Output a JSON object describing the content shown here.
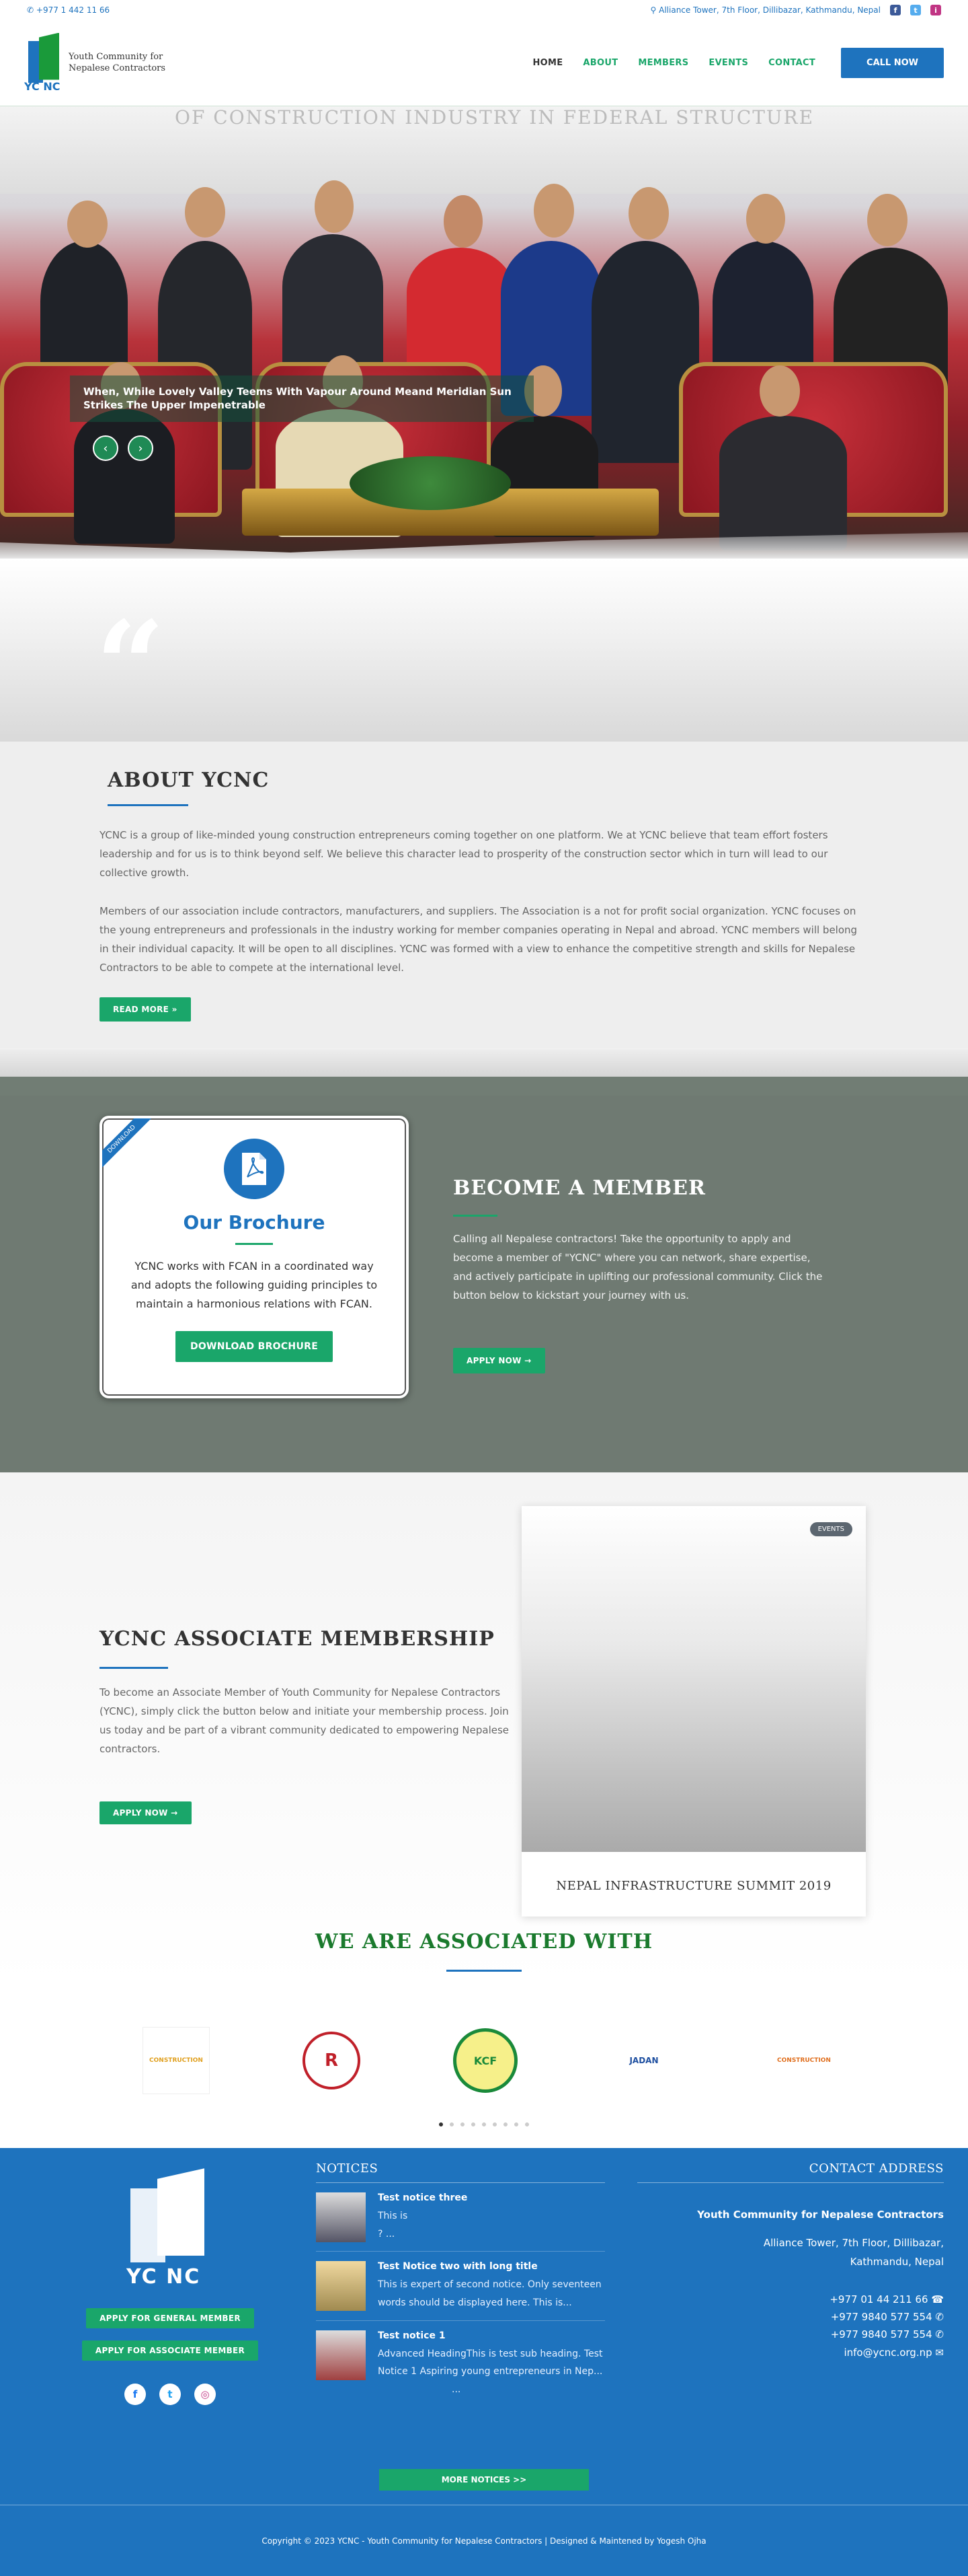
{
  "topbar": {
    "phone": "+977 1 442 11 66",
    "address": "Alliance Tower, 7th Floor, Dillibazar, Kathmandu, Nepal",
    "social": [
      {
        "name": "facebook",
        "glyph": "f",
        "color": "#3b5998"
      },
      {
        "name": "twitter",
        "glyph": "t",
        "color": "#55acee"
      },
      {
        "name": "instagram",
        "glyph": "i",
        "color": "#c13584"
      }
    ]
  },
  "brand": {
    "line1": "Youth Community for",
    "line2": "Nepalese Contractors",
    "mark": "YC NC"
  },
  "nav": {
    "items": [
      "HOME",
      "ABOUT",
      "MEMBERS",
      "EVENTS",
      "CONTACT"
    ],
    "call": "CALL NOW"
  },
  "hero": {
    "banner": "OF CONSTRUCTION INDUSTRY IN FEDERAL STRUCTURE",
    "caption": "When, While Lovely Valley Teems With Vapour Around Meand Meridian Sun Strikes The Upper Impenetrable",
    "prev": "‹",
    "next": "›"
  },
  "quote": {
    "mark": "“"
  },
  "about": {
    "title": "ABOUT YCNC",
    "p1": "YCNC is a group of like-minded young construction entrepreneurs coming together on one platform. We at YCNC believe that team effort fosters leadership and for us is to think beyond self. We believe this character lead to prosperity of the construction sector which in turn will lead to our collective growth.",
    "p2": "Members of our association include contractors, manufacturers, and suppliers. The Association is a not for profit social organization. YCNC focuses on the young entrepreneurs and professionals in the industry working for member companies operating in Nepal and abroad. YCNC members will belong in their individual capacity. It will be open to all disciplines. YCNC was formed with a view to enhance the competitive strength and skills for Nepalese Contractors to be able to compete at the international level.",
    "button": "READ MORE »"
  },
  "brochure": {
    "ribbon": "DOWNLOAD",
    "title": "Our Brochure",
    "text": "YCNC works with FCAN in a coordinated way and adopts the following guiding principles to maintain a harmonious relations with FCAN.",
    "button": "DOWNLOAD BROCHURE"
  },
  "member": {
    "title": "BECOME A MEMBER",
    "text": "Calling all Nepalese contractors! Take the opportunity to apply and become a member of \"YCNC\" where you can network, share expertise, and actively participate in uplifting our professional community. Click the button below to kickstart your journey with us.",
    "button": "APPLY NOW  →"
  },
  "associate": {
    "title": "YCNC ASSOCIATE MEMBERSHIP",
    "text": "To become an Associate Member of Youth Community for Nepalese Contractors (YCNC), simply click the button below and initiate your membership process. Join us today and be part of a vibrant community dedicated to empowering Nepalese contractors.",
    "button": "APPLY NOW  →",
    "event_badge": "EVENTS",
    "event_title": "NEPAL INFRASTRUCTURE SUMMIT 2019"
  },
  "associated": {
    "title": "WE ARE ASSOCIATED WITH",
    "partners": [
      {
        "name": "partner-1",
        "label": "CONSTRUCTION",
        "color": "#e0a020"
      },
      {
        "name": "partner-2",
        "label": "R",
        "color": "#c0202a"
      },
      {
        "name": "partner-3",
        "label": "KCF",
        "color": "#1a8a3a"
      },
      {
        "name": "partner-4",
        "label": "JADAN",
        "color": "#1e4fa0"
      },
      {
        "name": "partner-5",
        "label": "CONSTRUCTION",
        "color": "#e07020"
      }
    ]
  },
  "footer": {
    "mark": "YC NC",
    "btn_general": "APPLY FOR GENERAL MEMBER",
    "btn_associate": "APPLY FOR ASSOCIATE MEMBER",
    "social": [
      {
        "name": "facebook",
        "glyph": "f",
        "color": "#3b5998"
      },
      {
        "name": "twitter",
        "glyph": "t",
        "color": "#55acee"
      },
      {
        "name": "instagram",
        "glyph": "◎",
        "color": "#c13584"
      }
    ],
    "notices_title": "NOTICES",
    "notices": [
      {
        "title": "Test notice three",
        "excerpt": "This is",
        "more": "?                                        ..."
      },
      {
        "title": "Test Notice two with long title",
        "excerpt": "This is expert of second notice. Only seventeen words should be displayed here. This is...",
        "more": ""
      },
      {
        "title": "Test notice 1",
        "excerpt": "Advanced HeadingThis is test sub heading. Test Notice 1 Aspiring young entrepreneurs in Nep...",
        "more": "..."
      }
    ],
    "more_notices": "MORE NOTICES >>",
    "contact_title": "CONTACT ADDRESS",
    "org": "Youth Community for Nepalese Contractors",
    "address": [
      "Alliance Tower, 7th Floor, Dillibazar,",
      "Kathmandu, Nepal"
    ],
    "phones": [
      "+977 01 44 211 66",
      "+977 9840 577 554",
      "+977 9840 577 554"
    ],
    "email": "info@ycnc.org.np",
    "copyright": "Copyright © 2023 YCNC - Youth Community for Nepalese Contractors  | Designed & Maintened by Yogesh Ojha"
  }
}
